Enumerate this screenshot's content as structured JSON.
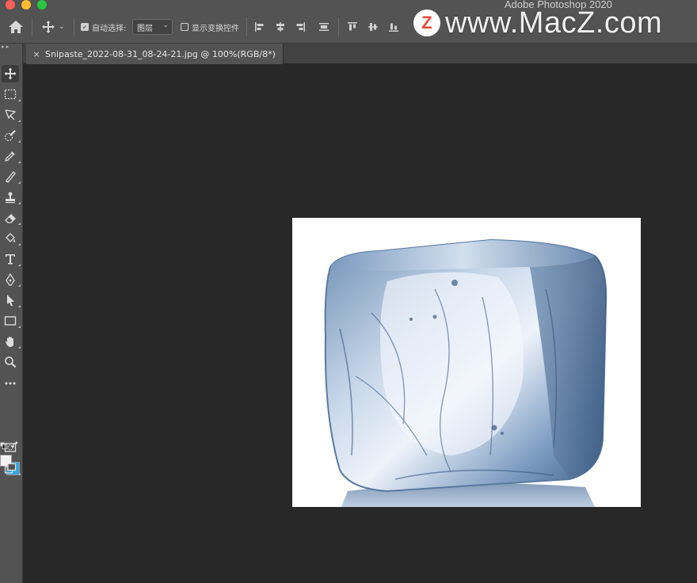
{
  "app": {
    "title": "Adobe Photoshop 2020",
    "window_controls": [
      {
        "name": "close",
        "color": "#ff5f57"
      },
      {
        "name": "minimize",
        "color": "#febc2e"
      },
      {
        "name": "zoom",
        "color": "#28c840"
      }
    ]
  },
  "options_bar": {
    "home_icon": "home-icon",
    "move_icon": "move-icon",
    "auto_select": {
      "label": "自动选择:",
      "checked": true
    },
    "target_select": {
      "value": "图层"
    },
    "transform_controls": {
      "label": "显示变换控件",
      "checked": false
    },
    "align_icons": [
      "align-left-icon",
      "align-hcenter-icon",
      "align-right-icon",
      "distribute-icon",
      "align-top-icon",
      "align-vcenter-icon",
      "align-bottom-icon"
    ]
  },
  "watermark": {
    "logo_letter": "Z",
    "text": "www.MacZ.com"
  },
  "tab": {
    "close_glyph": "×",
    "title": "Snipaste_2022-08-31_08-24-21.jpg @ 100%(RGB/8*)"
  },
  "toolbar": {
    "tools": [
      {
        "name": "move-tool",
        "icon": "move-icon",
        "active": true
      },
      {
        "name": "marquee-tool",
        "icon": "marquee-icon"
      },
      {
        "name": "lasso-tool",
        "icon": "lasso-icon"
      },
      {
        "name": "quick-select-tool",
        "icon": "quick-select-icon"
      },
      {
        "name": "eyedropper-tool",
        "icon": "eyedropper-icon"
      },
      {
        "name": "brush-tool",
        "icon": "brush-icon"
      },
      {
        "name": "stamp-tool",
        "icon": "stamp-icon"
      },
      {
        "name": "eraser-tool",
        "icon": "eraser-icon"
      },
      {
        "name": "paint-bucket-tool",
        "icon": "paint-bucket-icon"
      },
      {
        "name": "type-tool",
        "icon": "type-icon"
      },
      {
        "name": "pen-tool",
        "icon": "pen-icon"
      },
      {
        "name": "path-select-tool",
        "icon": "arrow-icon"
      },
      {
        "name": "rectangle-tool",
        "icon": "rectangle-icon"
      },
      {
        "name": "hand-tool",
        "icon": "hand-icon"
      },
      {
        "name": "zoom-tool",
        "icon": "zoom-icon"
      },
      {
        "name": "more-tools",
        "icon": "more-icon"
      }
    ],
    "foreground_color": "#f2f2f4",
    "background_color": "#32a7e4"
  }
}
